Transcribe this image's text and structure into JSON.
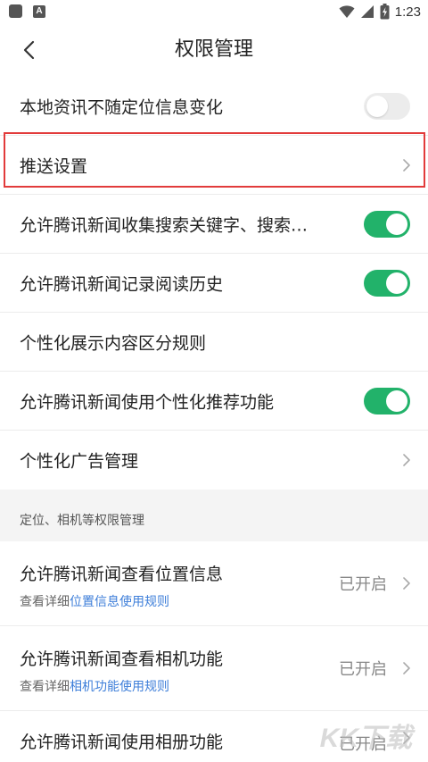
{
  "status_bar": {
    "time": "1:23",
    "app_icon_2_letter": "A"
  },
  "nav": {
    "title": "权限管理",
    "back_icon": "chevron-left-icon"
  },
  "settings": [
    {
      "label": "本地资讯不随定位信息变化",
      "control": "toggle",
      "state": "off"
    },
    {
      "label": "推送设置",
      "control": "chevron"
    },
    {
      "label": "允许腾讯新闻收集搜索关键字、搜索…",
      "control": "toggle",
      "state": "on"
    },
    {
      "label": "允许腾讯新闻记录阅读历史",
      "control": "toggle",
      "state": "on"
    },
    {
      "label": "个性化展示内容区分规则",
      "control": "none"
    },
    {
      "label": "允许腾讯新闻使用个性化推荐功能",
      "control": "toggle",
      "state": "on"
    },
    {
      "label": "个性化广告管理",
      "control": "chevron"
    }
  ],
  "section": {
    "title": "定位、相机等权限管理"
  },
  "permissions": [
    {
      "title": "允许腾讯新闻查看位置信息",
      "sub_prefix": "查看详细",
      "sub_link": "位置信息使用规则",
      "status": "已开启"
    },
    {
      "title": "允许腾讯新闻查看相机功能",
      "sub_prefix": "查看详细",
      "sub_link": "相机功能使用规则",
      "status": "已开启"
    },
    {
      "title": "允许腾讯新闻使用相册功能",
      "status": "已开启"
    }
  ],
  "watermark": {
    "text": "KK下载"
  },
  "colors": {
    "toggle_on": "#22b26a",
    "toggle_off": "#ececec",
    "highlight": "#e23b3b",
    "link": "#3d7ed9"
  }
}
